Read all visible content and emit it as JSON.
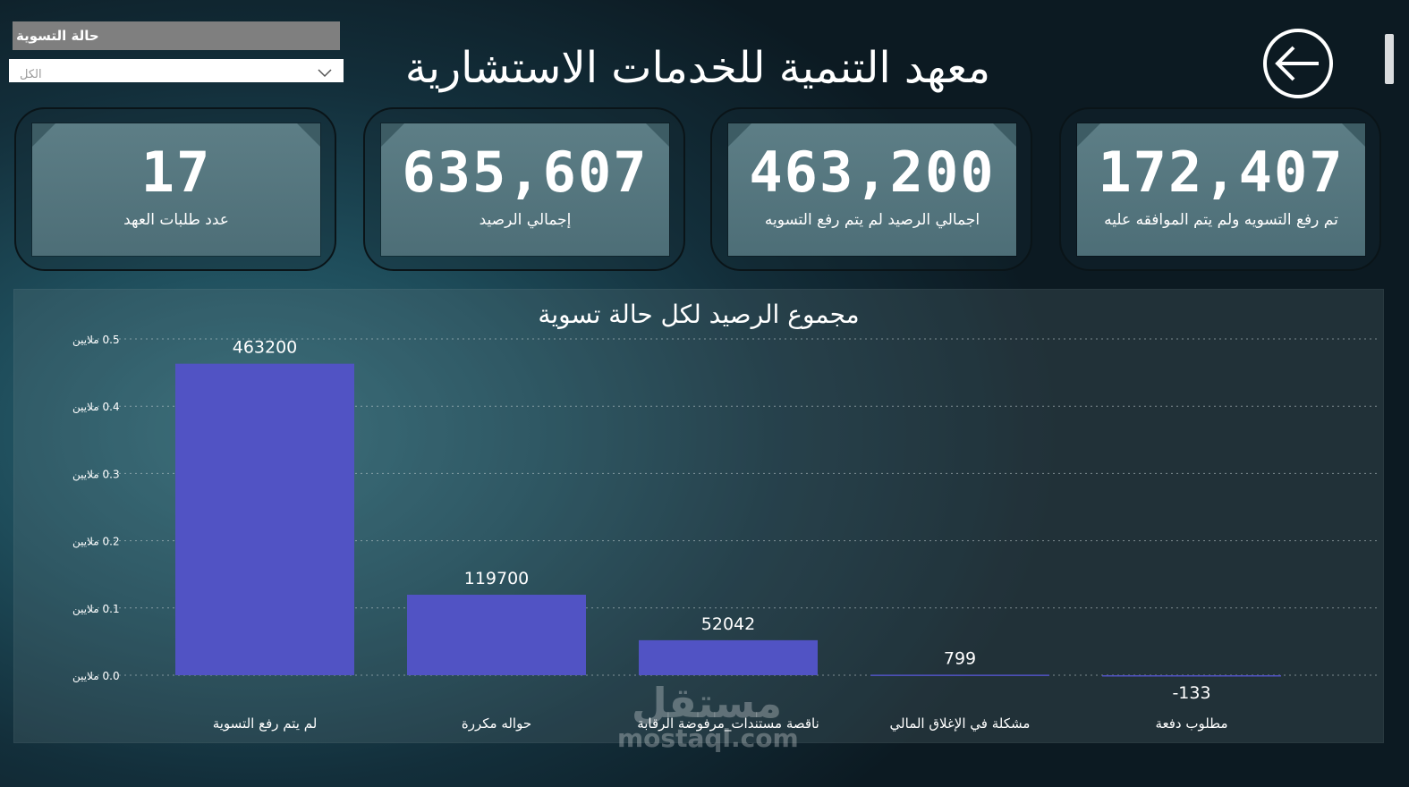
{
  "slicer": {
    "label": "حالة التسوية",
    "value": "الكل"
  },
  "header": {
    "title": "معهد التنمية للخدمات الاستشارية"
  },
  "kpis": [
    {
      "value": "17",
      "label": "عدد طلبات العهد"
    },
    {
      "value": "635,607",
      "label": "إجمالي الرصيد"
    },
    {
      "value": "463,200",
      "label": "اجمالي الرصيد لم يتم رفع التسويه"
    },
    {
      "value": "172,407",
      "label": "تم رفع التسويه ولم يتم الموافقه عليه"
    }
  ],
  "colors": {
    "bar": "#5153c4",
    "background": "#132f3b"
  },
  "chart_data": {
    "type": "bar",
    "title": "مجموع الرصيد لكل حالة تسوية",
    "categories": [
      "لم يتم رفع التسوية",
      "حواله مكررة",
      "ناقصة مستندات_مرفوضة الرقابة",
      "مشكلة في الإغلاق المالي",
      "مطلوب دفعة"
    ],
    "values": [
      463200,
      119700,
      52042,
      799,
      -133
    ],
    "y_ticks": [
      0,
      0.1,
      0.2,
      0.3,
      0.4,
      0.5
    ],
    "y_tick_labels": [
      "0.0 ملايين",
      "0.1 ملايين",
      "0.2 ملايين",
      "0.3 ملايين",
      "0.4 ملايين",
      "0.5 ملايين"
    ],
    "ylim": [
      0,
      500000
    ],
    "grid": true,
    "xlabel": "",
    "ylabel": ""
  },
  "watermark": {
    "arabic": "مستقل",
    "latin": "mostaql.com"
  }
}
